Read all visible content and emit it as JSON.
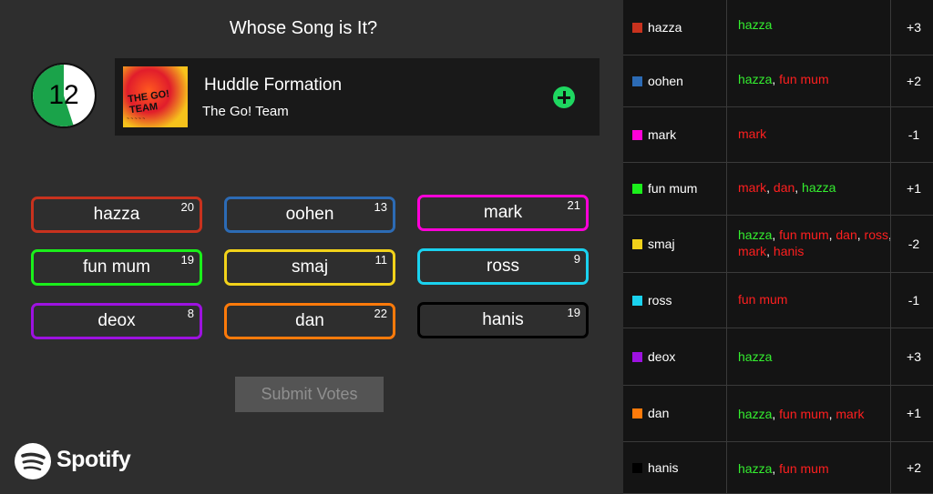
{
  "game": {
    "title": "Whose Song is It?",
    "timer": 12,
    "timer_fraction": 0.55,
    "submit_label": "Submit Votes"
  },
  "track": {
    "title": "Huddle Formation",
    "artist": "The Go! Team"
  },
  "players": [
    {
      "name": "hazza",
      "count": "20",
      "color": "#c8321e"
    },
    {
      "name": "oohen",
      "count": "13",
      "color": "#2c6bb5"
    },
    {
      "name": "mark",
      "count": "21",
      "color": "#ff00d8"
    },
    {
      "name": "fun mum",
      "count": "19",
      "color": "#1bef1b"
    },
    {
      "name": "smaj",
      "count": "11",
      "color": "#f2d21a"
    },
    {
      "name": "ross",
      "count": "9",
      "color": "#1ad2ef"
    },
    {
      "name": "deox",
      "count": "8",
      "color": "#9d12e0"
    },
    {
      "name": "dan",
      "count": "22",
      "color": "#ff7a0a"
    },
    {
      "name": "hanis",
      "count": "19",
      "color": "#000000"
    }
  ],
  "scoreboard": [
    {
      "name": "hazza",
      "color": "#c8321e",
      "delta": "+3",
      "votes": [
        {
          "who": "hazza",
          "ok": true
        }
      ]
    },
    {
      "name": "oohen",
      "color": "#2c6bb5",
      "delta": "+2",
      "votes": [
        {
          "who": "hazza",
          "ok": true
        },
        {
          "who": "fun mum",
          "ok": false
        }
      ]
    },
    {
      "name": "mark",
      "color": "#ff00d8",
      "delta": "-1",
      "votes": [
        {
          "who": "mark",
          "ok": false
        }
      ]
    },
    {
      "name": "fun mum",
      "color": "#1bef1b",
      "delta": "+1",
      "votes": [
        {
          "who": "mark",
          "ok": false
        },
        {
          "who": "dan",
          "ok": false
        },
        {
          "who": "hazza",
          "ok": true
        }
      ]
    },
    {
      "name": "smaj",
      "color": "#f2d21a",
      "delta": "-2",
      "votes": [
        {
          "who": "hazza",
          "ok": true
        },
        {
          "who": "fun mum",
          "ok": false
        },
        {
          "who": "dan",
          "ok": false
        },
        {
          "who": "ross",
          "ok": false
        },
        {
          "who": "mark",
          "ok": false
        },
        {
          "who": "hanis",
          "ok": false
        }
      ]
    },
    {
      "name": "ross",
      "color": "#1ad2ef",
      "delta": "-1",
      "votes": [
        {
          "who": "fun mum",
          "ok": false
        }
      ]
    },
    {
      "name": "deox",
      "color": "#9d12e0",
      "delta": "+3",
      "votes": [
        {
          "who": "hazza",
          "ok": true
        }
      ]
    },
    {
      "name": "dan",
      "color": "#ff7a0a",
      "delta": "+1",
      "votes": [
        {
          "who": "hazza",
          "ok": true
        },
        {
          "who": "fun mum",
          "ok": false
        },
        {
          "who": "mark",
          "ok": false
        }
      ]
    },
    {
      "name": "hanis",
      "color": "#000000",
      "delta": "+2",
      "votes": [
        {
          "who": "hazza",
          "ok": true
        },
        {
          "who": "fun mum",
          "ok": false
        }
      ]
    }
  ],
  "brand": {
    "name": "Spotify",
    "icon": "spotify-icon"
  },
  "colors": {
    "correct": "#34ef2f",
    "wrong": "#ff1f1f",
    "accent": "#1ed760"
  }
}
